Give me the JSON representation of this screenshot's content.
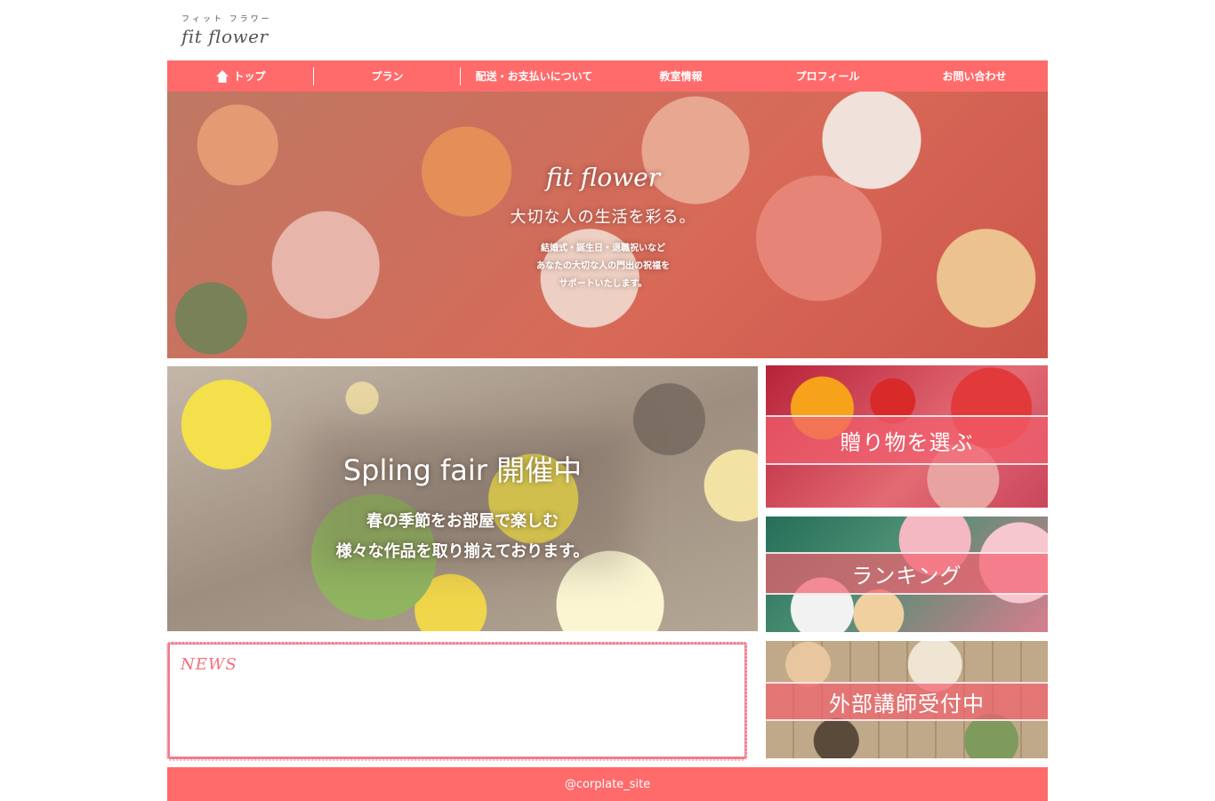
{
  "logo": {
    "kana": "フィット フラワー",
    "script": "fit flower"
  },
  "nav": {
    "items": [
      {
        "label": "トップ"
      },
      {
        "label": "プラン"
      },
      {
        "label": "配送・お支払いについて"
      },
      {
        "label": "教室情報"
      },
      {
        "label": "プロフィール"
      },
      {
        "label": "お問い合わせ"
      }
    ]
  },
  "hero": {
    "script": "fit flower",
    "title": "大切な人の生活を彩る。",
    "lines": [
      "結婚式・誕生日・退職祝いなど",
      "あなたの大切な人の門出の祝福を",
      "サポートいたします。"
    ]
  },
  "fair": {
    "title": "Spling fair 開催中",
    "lines": [
      "春の季節をお部屋で楽しむ",
      "様々な作品を取り揃えております。"
    ]
  },
  "banners": [
    {
      "label": "贈り物を選ぶ"
    },
    {
      "label": "ランキング"
    },
    {
      "label": "外部講師受付中"
    }
  ],
  "news": {
    "title": "NEWS"
  },
  "footer": {
    "text": "@corplate_site"
  },
  "colors": {
    "accent": "#ff6b6b",
    "news_border": "#f07b8c"
  },
  "icons": {
    "home": "home-icon"
  }
}
